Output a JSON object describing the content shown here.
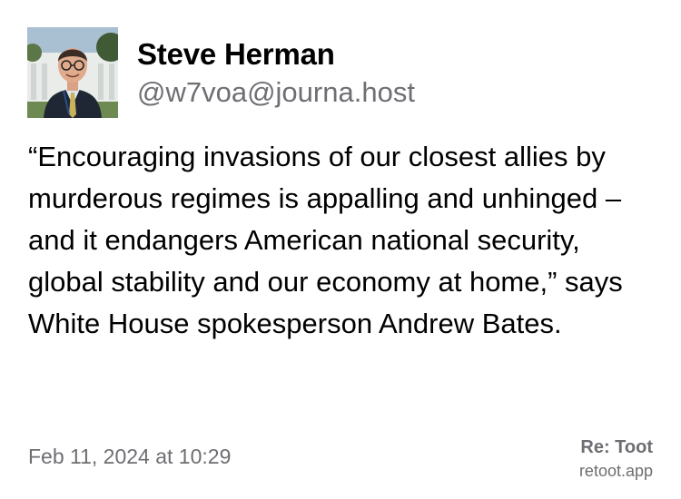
{
  "post": {
    "author": {
      "display_name": "Steve Herman",
      "handle": "@w7voa@journa.host"
    },
    "body": "“Encouraging invasions of our closest allies by murderous regimes is appalling and unhinged – and it endangers American national security, global stability and our economy at home,” says White House spokesperson Andrew Bates.",
    "timestamp": "Feb 11, 2024 at 10:29"
  },
  "branding": {
    "name": "Re: Toot",
    "site": "retoot.app"
  },
  "colors": {
    "text_primary": "#000000",
    "text_secondary": "#6e6e73",
    "background": "#ffffff"
  }
}
